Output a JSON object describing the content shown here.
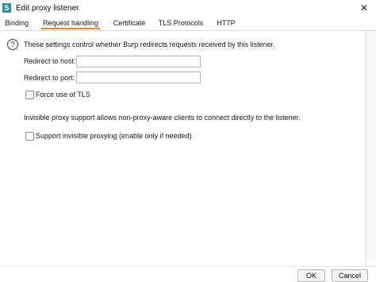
{
  "window": {
    "title": "Edit proxy listener",
    "app_icon_glyph": "S",
    "close_glyph": "✕"
  },
  "tabs": [
    {
      "label": "Binding",
      "active": false
    },
    {
      "label": "Request handling",
      "active": true
    },
    {
      "label": "Certificate",
      "active": false
    },
    {
      "label": "TLS Protocols",
      "active": false
    },
    {
      "label": "HTTP",
      "active": false
    }
  ],
  "request_handling": {
    "help_glyph": "?",
    "description": "These settings control whether Burp redirects requests received by this listener.",
    "redirect_host_label": "Redirect to host:",
    "redirect_host_value": "",
    "redirect_port_label": "Redirect to port:",
    "redirect_port_value": "",
    "force_tls_label": "Force use of TLS",
    "force_tls_checked": false,
    "invisible_note": "Invisible proxy support allows non-proxy-aware clients to connect directly to the listener.",
    "support_invisible_label": "Support invisible proxying (enable only if needed)",
    "support_invisible_checked": false
  },
  "footer": {
    "ok_label": "OK",
    "cancel_label": "Cancel"
  },
  "colors": {
    "accent_tab_underline": "#e8862a",
    "app_icon": "#2f8fa0"
  }
}
